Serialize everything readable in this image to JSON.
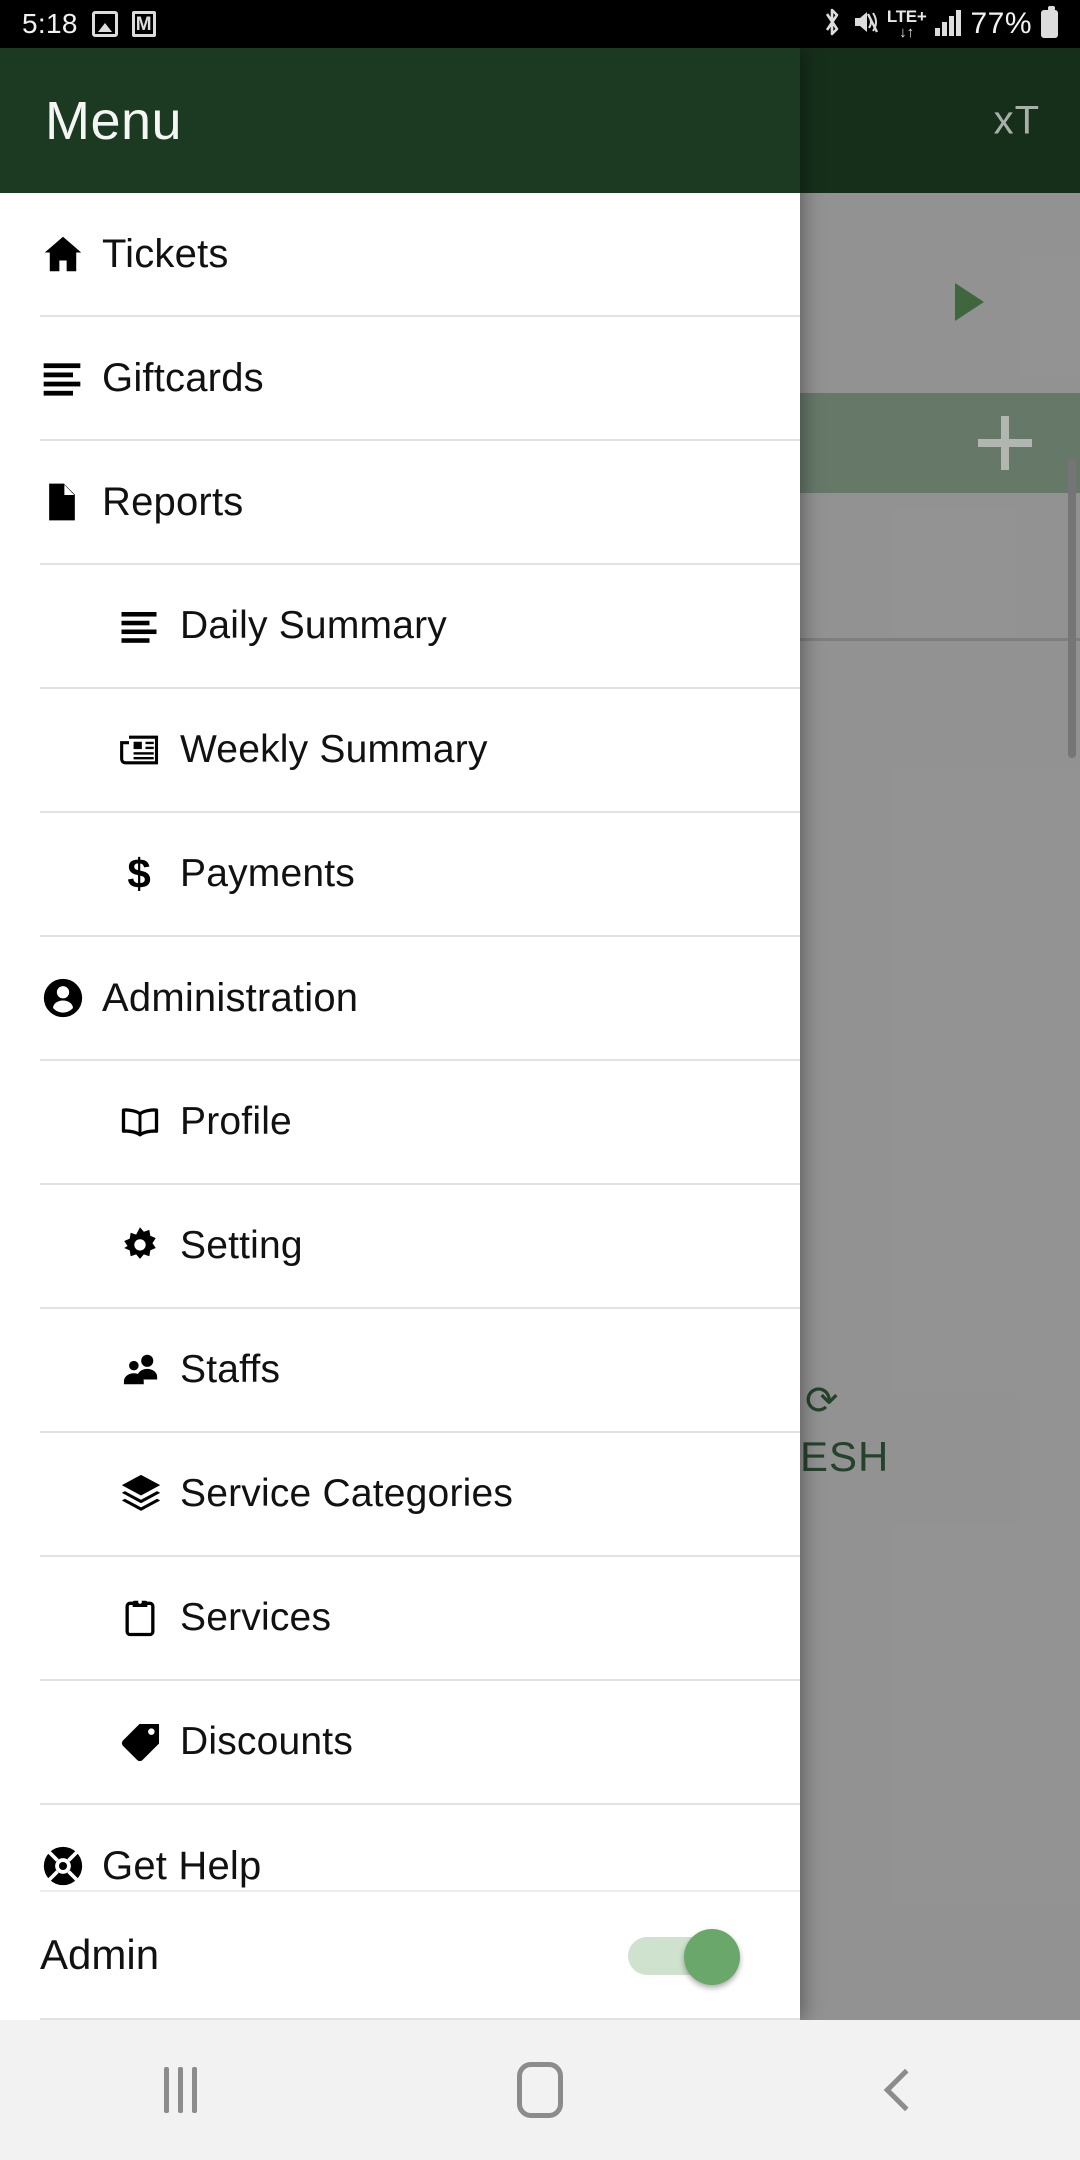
{
  "status_bar": {
    "time": "5:18",
    "battery_percent": "77%",
    "network": "LTE+",
    "icons": [
      "photo-icon",
      "gmail-icon",
      "bluetooth-icon",
      "mute-icon",
      "lte-icon",
      "signal-icon",
      "battery-icon"
    ]
  },
  "background_app": {
    "corner_label": "xT",
    "refresh_label": "ESH",
    "header_color": "#1c3a22",
    "accent_green": "#7d9480"
  },
  "drawer": {
    "title": "Menu",
    "items": [
      {
        "label": "Tickets",
        "icon": "home-icon",
        "level": 0
      },
      {
        "label": "Giftcards",
        "icon": "list-icon",
        "level": 0
      },
      {
        "label": "Reports",
        "icon": "file-icon",
        "level": 0
      },
      {
        "label": "Daily Summary",
        "icon": "list-icon",
        "level": 1
      },
      {
        "label": "Weekly Summary",
        "icon": "newspaper-icon",
        "level": 1
      },
      {
        "label": "Payments",
        "icon": "dollar-icon",
        "level": 1
      },
      {
        "label": "Administration",
        "icon": "user-circle-icon",
        "level": 0
      },
      {
        "label": "Profile",
        "icon": "book-icon",
        "level": 1
      },
      {
        "label": "Setting",
        "icon": "gear-icon",
        "level": 1
      },
      {
        "label": "Staffs",
        "icon": "people-icon",
        "level": 1
      },
      {
        "label": "Service Categories",
        "icon": "layers-icon",
        "level": 1
      },
      {
        "label": "Services",
        "icon": "clipboard-icon",
        "level": 1
      },
      {
        "label": "Discounts",
        "icon": "tag-icon",
        "level": 1
      },
      {
        "label": "Get Help",
        "icon": "lifebuoy-icon",
        "level": 0
      }
    ],
    "footer": {
      "label": "Admin",
      "toggle_on": true,
      "toggle_track_color": "#cfe2cd",
      "toggle_knob_color": "#6aa76a"
    }
  },
  "nav_bar": {
    "recent_label": "recent-apps",
    "home_label": "home",
    "back_label": "back"
  }
}
